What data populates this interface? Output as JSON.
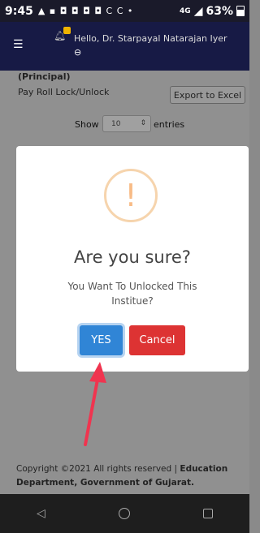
{
  "status_bar": {
    "time": "9:45",
    "notification_icons": "▲ ▪ ◘ ◘ ◘ ◘ C C •",
    "network": "4G",
    "battery": "63%"
  },
  "header": {
    "greeting": "Hello, Dr. Starpayal Natarajan Iyer",
    "menu_icon": "hamburger-icon",
    "bell_icon": "bell-icon",
    "user_icon": "user-icon"
  },
  "page": {
    "section_label": "(Principal)",
    "title": "Pay Roll Lock/Unlock",
    "export_button": "Export to Excel",
    "show_label": "Show",
    "entries_value": "10",
    "entries_label": "entries"
  },
  "dialog": {
    "icon_symbol": "!",
    "title": "Are you sure?",
    "text": "You Want To Unlocked This Institue?",
    "confirm_label": "YES",
    "cancel_label": "Cancel"
  },
  "footer": {
    "copyright_text": "Copyright ©2021 All rights reserved | ",
    "department": "Education Department, Government of Gujarat."
  },
  "nav": {
    "back": "◁",
    "home": "home-icon",
    "recent": "recent-apps-icon"
  },
  "colors": {
    "appbar": "#171a45",
    "confirm": "#3085d6",
    "cancel": "#dd3333",
    "warning": "#f8bb86",
    "annotation_arrow": "#f0344f"
  }
}
